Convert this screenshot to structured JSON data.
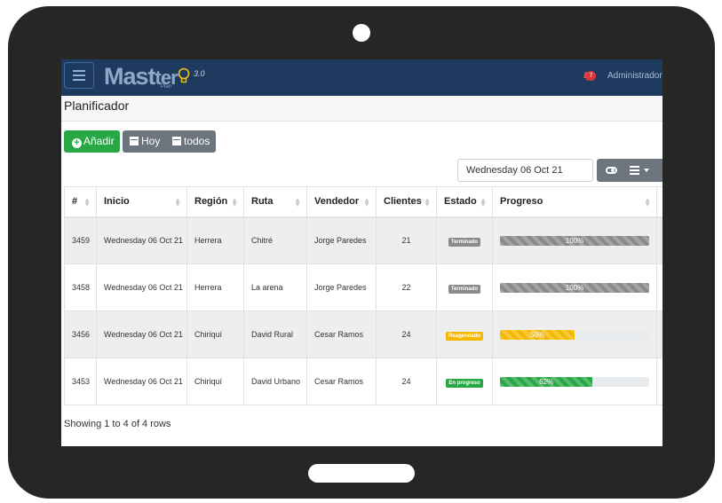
{
  "app": {
    "logo_text": "Mast",
    "logo_sub": "Plan",
    "version": "3.0"
  },
  "header": {
    "notifications": "7",
    "user": "Administrador"
  },
  "page": {
    "title": "Planificador"
  },
  "toolbar": {
    "add_label": "Añadir",
    "today_label": "Hoy",
    "all_label": "todos"
  },
  "date_filter": {
    "value": "Wednesday 06 Oct 21"
  },
  "table": {
    "columns": [
      "#",
      "Inicio",
      "Región",
      "Ruta",
      "Vendedor",
      "Clientes",
      "Estado",
      "Progreso"
    ],
    "rows": [
      {
        "id": "3459",
        "inicio": "Wednesday 06 Oct 21",
        "region": "Herrera",
        "ruta": "Chitré",
        "vendedor": "Jorge Paredes",
        "clientes": "21",
        "estado": "Terminado",
        "estado_color": "#8a8a8a",
        "progreso": 100,
        "progreso_label": "100%",
        "bar_color": "#8a8a8a"
      },
      {
        "id": "3458",
        "inicio": "Wednesday 06 Oct 21",
        "region": "Herrera",
        "ruta": "La arena",
        "vendedor": "Jorge Paredes",
        "clientes": "22",
        "estado": "Terminado",
        "estado_color": "#8a8a8a",
        "progreso": 100,
        "progreso_label": "100%",
        "bar_color": "#8a8a8a"
      },
      {
        "id": "3456",
        "inicio": "Wednesday 06 Oct 21",
        "region": "Chiriquí",
        "ruta": "David Rural",
        "vendedor": "Cesar Ramos",
        "clientes": "24",
        "estado": "Reagendado",
        "estado_color": "#f5b800",
        "progreso": 50,
        "progreso_label": "50%",
        "bar_color": "#f5b800"
      },
      {
        "id": "3453",
        "inicio": "Wednesday 06 Oct 21",
        "region": "Chiriquí",
        "ruta": "David Urbano",
        "vendedor": "Cesar Ramos",
        "clientes": "24",
        "estado": "En progreso",
        "estado_color": "#28a745",
        "progreso": 62,
        "progreso_label": "62%",
        "bar_color": "#28a745"
      }
    ]
  },
  "footer": {
    "summary": "Showing 1 to 4 of 4 rows"
  }
}
